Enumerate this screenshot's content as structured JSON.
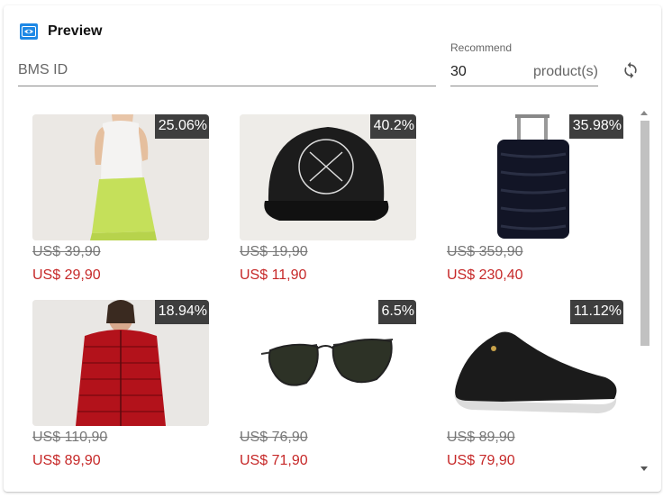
{
  "header": {
    "title": "Preview",
    "icon": "eye-icon",
    "accent": "#1e88e5"
  },
  "form": {
    "bms_id_placeholder": "BMS ID",
    "bms_id_value": "",
    "recommend_label": "Recommend",
    "recommend_value": "30",
    "recommend_suffix": "product(s)"
  },
  "colors": {
    "discount_bg": "#3e3e3e",
    "new_price": "#c62828",
    "old_price": "#777777"
  },
  "products": [
    {
      "discount": "25.06%",
      "old_price": "US$ 39,90",
      "new_price": "US$ 29,90",
      "image": "woman-tennis-skirt"
    },
    {
      "discount": "40.2%",
      "old_price": "US$ 19,90",
      "new_price": "US$ 11,90",
      "image": "black-cap"
    },
    {
      "discount": "35.98%",
      "old_price": "US$ 359,90",
      "new_price": "US$ 230,40",
      "image": "black-suitcase"
    },
    {
      "discount": "18.94%",
      "old_price": "US$ 110,90",
      "new_price": "US$ 89,90",
      "image": "red-puffer-jacket"
    },
    {
      "discount": "6.5%",
      "old_price": "US$ 76,90",
      "new_price": "US$ 71,90",
      "image": "aviator-sunglasses"
    },
    {
      "discount": "11.12%",
      "old_price": "US$ 89,90",
      "new_price": "US$ 79,90",
      "image": "black-sneaker"
    }
  ]
}
